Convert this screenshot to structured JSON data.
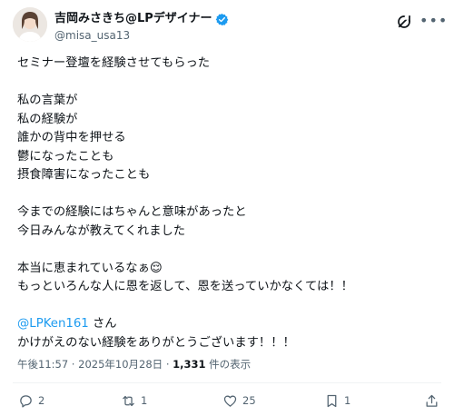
{
  "author": {
    "display_name": "吉岡みさきち@LPデザイナー",
    "handle": "@misa_usa13"
  },
  "tweet": {
    "paragraphs": [
      [
        "セミナー登壇を経験させてもらった"
      ],
      [
        "私の言葉が",
        "私の経験が",
        "誰かの背中を押せる",
        "鬱になったことも",
        "摂食障害になったことも"
      ],
      [
        "今までの経験にはちゃんと意味があったと",
        "今日みんなが教えてくれました"
      ],
      [
        "本当に恵まれているなぁ😌",
        "もっといろんな人に恩を返して、恩を送っていかなくては！！"
      ]
    ],
    "mention": "@LPKen161",
    "mention_suffix": " さん",
    "closing": "かけがえのない経験をありがとうございます！！！"
  },
  "meta": {
    "time": "午後11:57",
    "separator": " · ",
    "date": "2025年10月28日",
    "views": "1,331",
    "views_suffix": " 件の表示"
  },
  "actions": {
    "reply_count": "2",
    "retweet_count": "1",
    "like_count": "25",
    "bookmark_count": "1"
  },
  "colors": {
    "accent": "#1d9bf0",
    "secondary_text": "#536471"
  },
  "icons": {
    "verified": "verified-badge-icon",
    "grok": "grok-icon",
    "more": "more-icon",
    "reply": "reply-icon",
    "retweet": "retweet-icon",
    "like": "heart-icon",
    "bookmark": "bookmark-icon",
    "share": "share-icon"
  }
}
